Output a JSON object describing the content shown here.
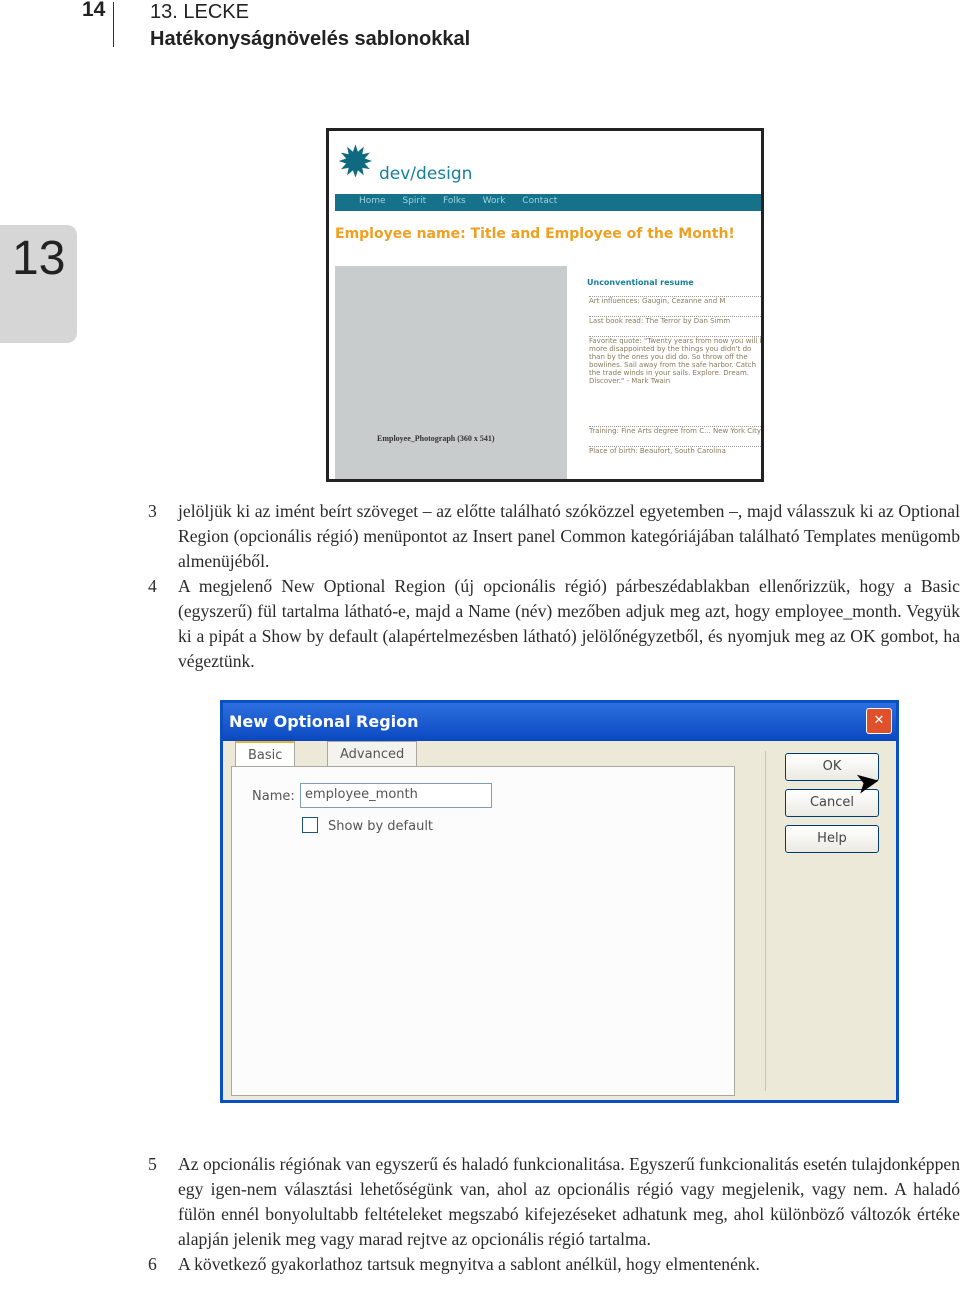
{
  "header": {
    "page_number": "14",
    "lesson": "13. LECKE",
    "subtitle": "Hatékonyságnövelés sablonokkal"
  },
  "chapter_tab": "13",
  "screenshot1": {
    "logo": "dev/design",
    "nav": [
      "Home",
      "Spirit",
      "Folks",
      "Work",
      "Contact"
    ],
    "heading": "Employee name: Title and Employee of the Month!",
    "photo_placeholder": "Employee_Photograph (360 x 541)",
    "section": "Unconventional resume",
    "rows": [
      {
        "label": "Art influences:",
        "value": "Gaugin, Cezanne and M"
      },
      {
        "label": "Last book read:",
        "value": "The Terror by Dan Simm"
      },
      {
        "label": "Favorite quote:",
        "value": "\"Twenty years from now you will be more disappointed by the things you didn't do than by the ones you did do. So throw off the bowlines. Sail away from the safe harbor. Catch the trade winds in your sails. Explore. Dream. Discover.\" - Mark Twain"
      },
      {
        "label": "Training:",
        "value": "Fine Arts degree from C... New York City"
      },
      {
        "label": "Place of birth:",
        "value": "Beaufort, South Carolina"
      }
    ]
  },
  "steps_a": [
    {
      "n": "3",
      "text": "jelöljük ki az imént beírt szöveget – az előtte található szóközzel egyetemben –, majd válasszuk ki az Optional Region (opcionális régió) menüpontot az Insert panel Common kategóriájában található Templates menügomb almenüjéből."
    },
    {
      "n": "4",
      "text": "A megjelenő New Optional Region (új opcionális régió) párbeszédablakban ellenőrizzük, hogy a Basic (egyszerű) fül tartalma látható-e, majd a Name (név) mezőben adjuk meg azt, hogy employee_month. Vegyük ki a pipát a Show by default (alapértelmezésben látható) jelölőnégyzetből, és nyomjuk meg az OK gombot, ha végeztünk."
    }
  ],
  "dialog": {
    "title": "New Optional Region",
    "tabs": [
      "Basic",
      "Advanced"
    ],
    "active_tab": "Basic",
    "name_label": "Name:",
    "name_value": "employee_month",
    "checkbox_label": "Show by default",
    "checkbox_checked": false,
    "buttons": [
      "OK",
      "Cancel",
      "Help"
    ]
  },
  "steps_b": [
    {
      "n": "5",
      "text": "Az opcionális régiónak van egyszerű és haladó funkcionalitása. Egyszerű funkcionalitás esetén tulajdonképpen egy igen-nem választási lehetőségünk van, ahol az opcionális régió vagy megjelenik, vagy nem. A haladó fülön ennél bonyolultabb feltételeket megszabó kifejezéseket adhatunk meg, ahol különböző változók értéke alapján jelenik meg vagy marad rejtve az opcionális régió tartalma."
    },
    {
      "n": "6",
      "text": "A következő gyakorlathoz tartsuk megnyitva a sablont anélkül, hogy elmentenénk."
    }
  ]
}
